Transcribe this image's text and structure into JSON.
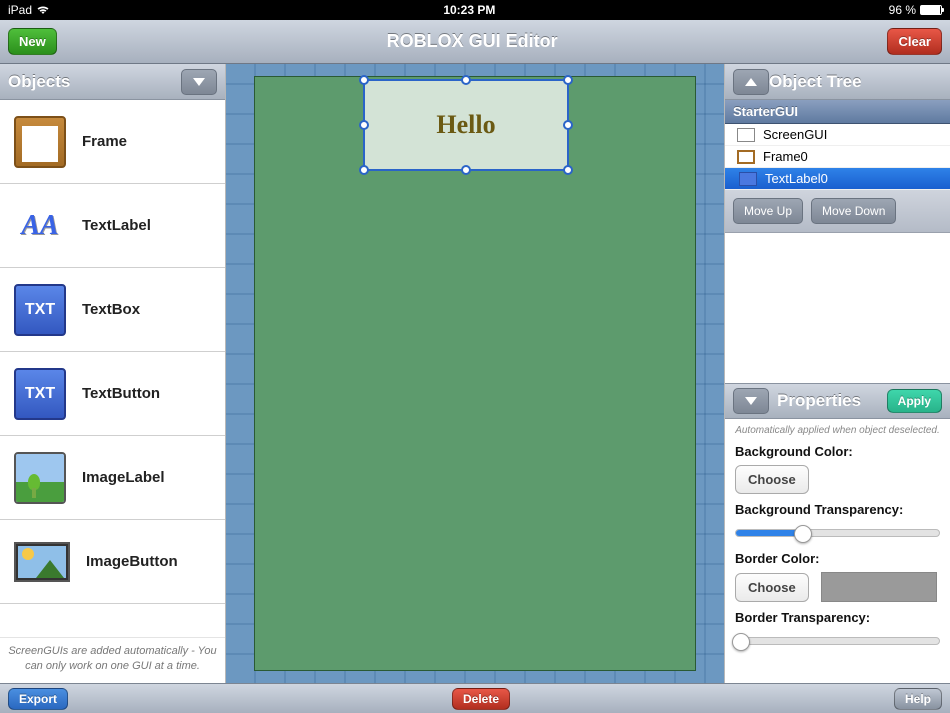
{
  "status": {
    "carrier": "iPad",
    "time": "10:23 PM",
    "battery_pct": "96 %"
  },
  "toolbar": {
    "new_label": "New",
    "title": "ROBLOX GUI Editor",
    "clear_label": "Clear"
  },
  "objects": {
    "title": "Objects",
    "items": [
      {
        "label": "Frame"
      },
      {
        "label": "TextLabel"
      },
      {
        "label": "TextBox"
      },
      {
        "label": "TextButton"
      },
      {
        "label": "ImageLabel"
      },
      {
        "label": "ImageButton"
      }
    ],
    "footnote": "ScreenGUIs are added automatically - You can only work on one GUI at a time."
  },
  "canvas": {
    "selected_text": "Hello"
  },
  "tree": {
    "title": "Object Tree",
    "root": "StarterGUI",
    "rows": [
      {
        "label": "ScreenGUI"
      },
      {
        "label": "Frame0"
      },
      {
        "label": "TextLabel0"
      }
    ],
    "move_up": "Move Up",
    "move_down": "Move Down"
  },
  "props": {
    "title": "Properties",
    "apply": "Apply",
    "note": "Automatically applied when object deselected.",
    "bg_color_label": "Background Color:",
    "choose": "Choose",
    "bg_trans_label": "Background Transparency:",
    "bg_trans_value": 33,
    "border_color_label": "Border Color:",
    "border_color_hex": "#9a9a9a",
    "border_trans_label": "Border Transparency:",
    "border_trans_value": 0
  },
  "bottom": {
    "export": "Export",
    "delete": "Delete",
    "help": "Help"
  }
}
